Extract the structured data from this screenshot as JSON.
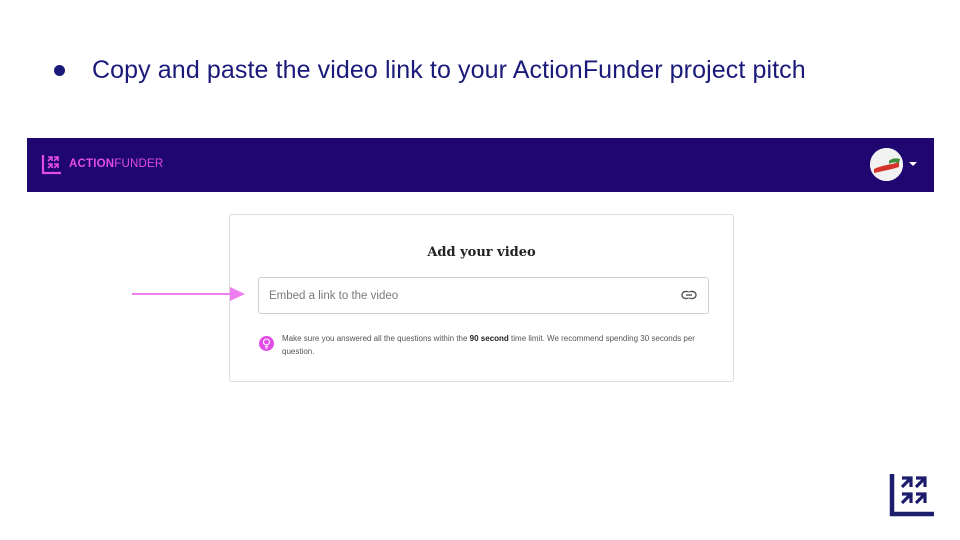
{
  "slide": {
    "bullet_text": "Copy and paste the video link to your ActionFunder project pitch"
  },
  "navbar": {
    "brand_bold": "ACTION",
    "brand_light": "FUNDER",
    "brand_icon": "actionfunder-logo-icon",
    "avatar_icon": "user-avatar",
    "menu_icon": "caret-down-icon",
    "background_color": "#200670",
    "brand_color": "#e24ce6"
  },
  "card": {
    "title": "Add your video",
    "input": {
      "value": "",
      "placeholder": "Embed a link to the video",
      "icon": "link-icon"
    },
    "tip": {
      "icon": "lightbulb-icon",
      "text_before": "Make sure you answered all the questions within the ",
      "text_bold": "90 second",
      "text_after": " time limit. We recommend spending 30 seconds per question."
    }
  },
  "annotation": {
    "arrow_color": "#ee7ef0",
    "arrow_icon": "pointer-arrow"
  },
  "footer": {
    "logo_icon": "actionfunder-logo-icon",
    "logo_color": "#1d1d6e"
  }
}
